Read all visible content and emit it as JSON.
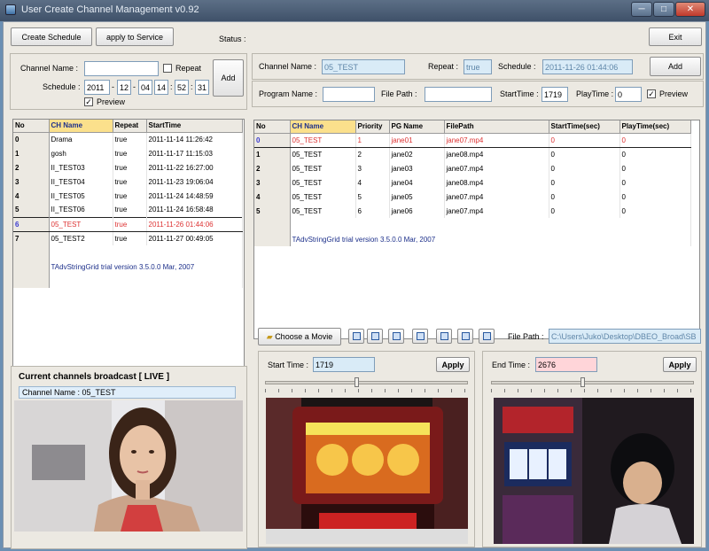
{
  "window": {
    "title": "User Create Channel Management v0.92",
    "min_glyph": "─",
    "max_glyph": "□",
    "close_glyph": "✕"
  },
  "toolbar": {
    "create_schedule": "Create Schedule",
    "apply_service": "apply to Service",
    "status_label": "Status :",
    "exit": "Exit"
  },
  "left_form": {
    "channel_name_label": "Channel Name :",
    "channel_name_value": "",
    "repeat_label": "Repeat",
    "repeat_checked": "",
    "schedule_label": "Schedule :",
    "year": "2011",
    "month": "12",
    "day": "04",
    "hour": "14",
    "minute": "52",
    "second": "31",
    "sep_dash": "-",
    "sep_colon": ":",
    "preview_label": "Preview",
    "preview_checked": "✓",
    "add": "Add"
  },
  "channel_grid": {
    "columns": [
      "No",
      "CH Name",
      "Repeat",
      "StartTime"
    ],
    "rows": [
      {
        "no": "0",
        "name": "Drama",
        "repeat": "true",
        "start": "2011-11-14 11:26:42"
      },
      {
        "no": "1",
        "name": "gosh",
        "repeat": "true",
        "start": "2011-11-17 11:15:03"
      },
      {
        "no": "2",
        "name": "II_TEST03",
        "repeat": "true",
        "start": "2011-11-22 16:27:00"
      },
      {
        "no": "3",
        "name": "II_TEST04",
        "repeat": "true",
        "start": "2011-11-23 19:06:04"
      },
      {
        "no": "4",
        "name": "II_TEST05",
        "repeat": "true",
        "start": "2011-11-24 14:48:59"
      },
      {
        "no": "5",
        "name": "II_TEST06",
        "repeat": "true",
        "start": "2011-11-24 16:58:48"
      },
      {
        "no": "6",
        "name": "05_TEST",
        "repeat": "true",
        "start": "2011-11-26 01:44:06"
      },
      {
        "no": "7",
        "name": "05_TEST2",
        "repeat": "true",
        "start": "2011-11-27 00:49:05"
      }
    ],
    "trial": "TAdvStringGrid trial version 3.5.0.0 Mar, 2007"
  },
  "live": {
    "title": "Current channels broadcast [ LIVE ]",
    "channel_label": "Channel Name : 05_TEST"
  },
  "right_top": {
    "channel_name_label": "Channel Name :",
    "channel_name_value": "05_TEST",
    "repeat_label": "Repeat :",
    "repeat_value": "true",
    "schedule_label": "Schedule :",
    "schedule_value": "2011-11-26 01:44:06",
    "add": "Add"
  },
  "program_form": {
    "program_name_label": "Program Name :",
    "program_name_value": "",
    "file_path_label": "File Path :",
    "file_path_value": "",
    "start_time_label": "StartTime :",
    "start_time_value": "1719",
    "play_time_label": "PlayTime :",
    "play_time_value": "0",
    "preview_label": "Preview",
    "preview_checked": "✓"
  },
  "program_grid": {
    "columns": [
      "No",
      "CH Name",
      "Priority",
      "PG Name",
      "FilePath",
      "StartTime(sec)",
      "PlayTime(sec)"
    ],
    "rows": [
      {
        "no": "0",
        "ch": "05_TEST",
        "pri": "1",
        "pg": "jane01",
        "file": "jane07.mp4",
        "start": "0",
        "play": "0"
      },
      {
        "no": "1",
        "ch": "05_TEST",
        "pri": "2",
        "pg": "jane02",
        "file": "jane08.mp4",
        "start": "0",
        "play": "0"
      },
      {
        "no": "2",
        "ch": "05_TEST",
        "pri": "3",
        "pg": "jane03",
        "file": "jane07.mp4",
        "start": "0",
        "play": "0"
      },
      {
        "no": "3",
        "ch": "05_TEST",
        "pri": "4",
        "pg": "jane04",
        "file": "jane08.mp4",
        "start": "0",
        "play": "0"
      },
      {
        "no": "4",
        "ch": "05_TEST",
        "pri": "5",
        "pg": "jane05",
        "file": "jane07.mp4",
        "start": "0",
        "play": "0"
      },
      {
        "no": "5",
        "ch": "05_TEST",
        "pri": "6",
        "pg": "jane06",
        "file": "jane07.mp4",
        "start": "0",
        "play": "0"
      }
    ],
    "trial": "TAdvStringGrid trial version 3.5.0.0 Mar, 2007"
  },
  "movie_bar": {
    "choose": "Choose a Movie",
    "file_path_label": "File Path :",
    "file_path_value": "C:\\Users\\Juko\\Desktop\\DBEO_Broad\\SB"
  },
  "start_panel": {
    "label": "Start Time :",
    "value": "1719",
    "apply": "Apply",
    "position": 0.44
  },
  "end_panel": {
    "label": "End Time :",
    "value": "2676",
    "apply": "Apply",
    "position": 0.44
  }
}
